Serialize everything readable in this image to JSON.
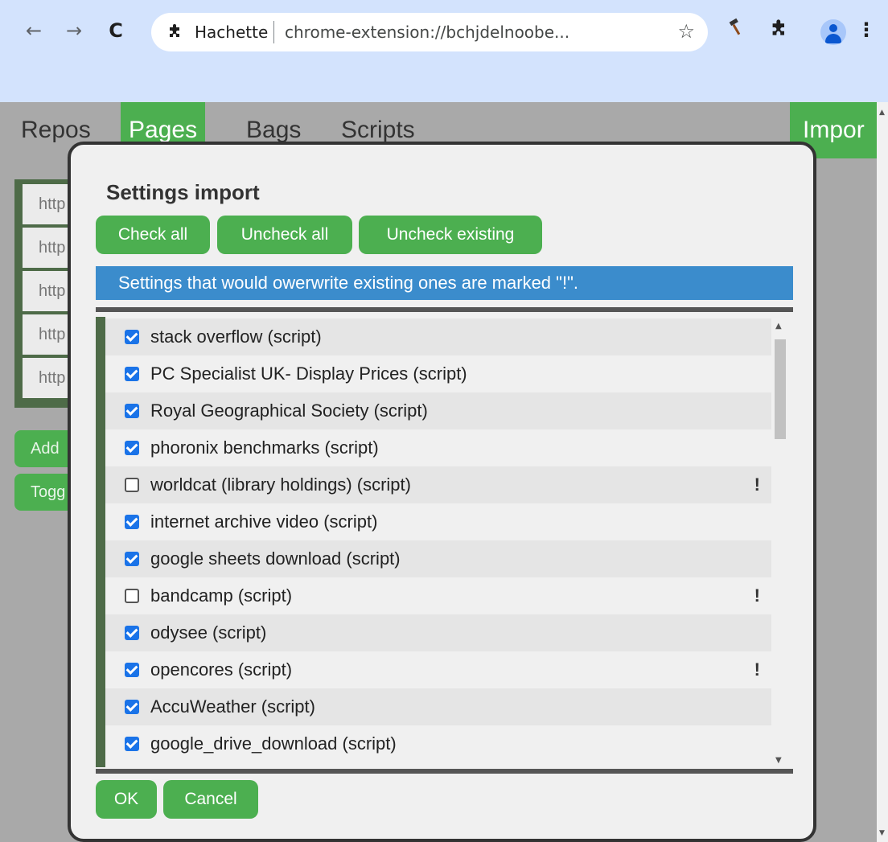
{
  "browser": {
    "back_icon": "←",
    "forward_icon": "→",
    "reload_icon": "C",
    "extension_icon": "puzzle-icon",
    "site_name": "Hachette",
    "url": "chrome-extension://bchjdelnoobe...",
    "star_icon": "☆",
    "hammer_icon": "hammer-icon",
    "puzzle_icon": "puzzle-icon",
    "menu_icon": "⋮"
  },
  "page": {
    "tabs": [
      "Repos",
      "Pages",
      "Bags",
      "Scripts"
    ],
    "active_tab": "Pages",
    "import_tab": "Impor",
    "url_items": [
      "http",
      "http",
      "http",
      "http",
      "http"
    ],
    "add_button": "Add",
    "toggle_button": "Togg"
  },
  "dialog": {
    "title": "Settings import",
    "check_all": "Check all",
    "uncheck_all": "Uncheck all",
    "uncheck_existing": "Uncheck existing",
    "info": "Settings that would owerwrite existing ones are marked \"!\".",
    "items": [
      {
        "label": "stack overflow (script)",
        "checked": true,
        "existing": ""
      },
      {
        "label": "PC Specialist UK- Display Prices (script)",
        "checked": true,
        "existing": ""
      },
      {
        "label": "Royal Geographical Society (script)",
        "checked": true,
        "existing": ""
      },
      {
        "label": "phoronix benchmarks (script)",
        "checked": true,
        "existing": ""
      },
      {
        "label": "worldcat (library holdings) (script)",
        "checked": false,
        "existing": "!"
      },
      {
        "label": "internet archive video (script)",
        "checked": true,
        "existing": ""
      },
      {
        "label": "google sheets download (script)",
        "checked": true,
        "existing": ""
      },
      {
        "label": "bandcamp (script)",
        "checked": false,
        "existing": "!"
      },
      {
        "label": "odysee (script)",
        "checked": true,
        "existing": ""
      },
      {
        "label": "opencores (script)",
        "checked": true,
        "existing": "!"
      },
      {
        "label": "AccuWeather (script)",
        "checked": true,
        "existing": ""
      },
      {
        "label": "google_drive_download (script)",
        "checked": true,
        "existing": ""
      }
    ],
    "ok": "OK",
    "cancel": "Cancel"
  },
  "colors": {
    "accent_green": "#4caf50",
    "info_blue": "#3b8ccc",
    "checkbox_blue": "#1a73e8",
    "browser_bar": "#d3e3fd"
  }
}
